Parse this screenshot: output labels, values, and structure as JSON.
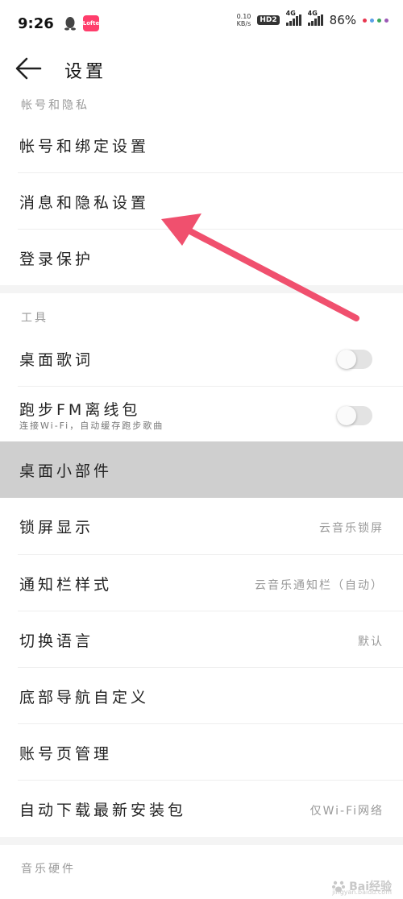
{
  "status_bar": {
    "time": "9:26",
    "app_badge": "Lofter",
    "net_speed_value": "0.10",
    "net_speed_unit": "KB/s",
    "hd_label": "HD",
    "hd_number": "2",
    "signal1_label": "4G",
    "signal2_label": "4G",
    "battery": "86%",
    "dot_colors": [
      "#e8364f",
      "#5aa0e8",
      "#3aa85a",
      "#9b59b6"
    ]
  },
  "toolbar": {
    "title": "设置"
  },
  "sections": {
    "account_header": "帐号和隐私",
    "tools_header": "工具",
    "music_hw_header": "音乐硬件"
  },
  "rows": {
    "account_binding": "帐号和绑定设置",
    "message_privacy": "消息和隐私设置",
    "login_protect": "登录保护",
    "desktop_lyrics": "桌面歌词",
    "running_fm": "跑步FM离线包",
    "running_fm_sub": "连接Wi-Fi，自动缓存跑步歌曲",
    "desktop_widget": "桌面小部件",
    "lockscreen": "锁屏显示",
    "lockscreen_value": "云音乐锁屏",
    "notification_style": "通知栏样式",
    "notification_value": "云音乐通知栏（自动）",
    "language": "切换语言",
    "language_value": "默认",
    "bottom_nav": "底部导航自定义",
    "account_page": "账号页管理",
    "auto_download": "自动下载最新安装包",
    "auto_download_value": "仅Wi-Fi网络"
  },
  "toggles": {
    "desktop_lyrics_on": false,
    "running_fm_on": false
  },
  "watermark": {
    "text": "Bai经验",
    "sub": "jingyan.baidu.com"
  },
  "colors": {
    "arrow": "#f0506e",
    "highlight_row": "#cfcfcf",
    "section_text": "#9a9a9a"
  }
}
